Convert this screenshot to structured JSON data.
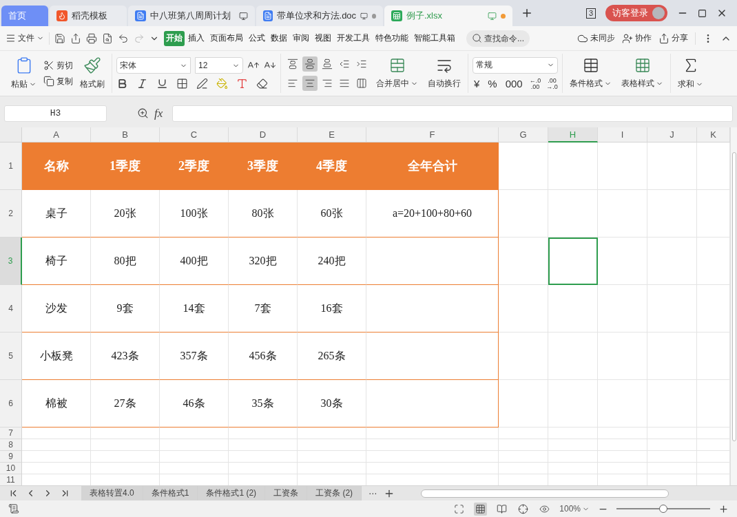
{
  "doc_tabs": [
    {
      "label": "首页",
      "kind": "home",
      "selected": false,
      "unsaved": false
    },
    {
      "label": "稻壳模板",
      "kind": "docer",
      "selected": false,
      "unsaved": false
    },
    {
      "label": "中八班第八周周计划",
      "kind": "word",
      "selected": false,
      "unsaved": false
    },
    {
      "label": "带单位求和方法.doc",
      "kind": "word",
      "selected": false,
      "unsaved": true
    },
    {
      "label": "例子.xlsx",
      "kind": "sheet",
      "selected": true,
      "unsaved": true
    }
  ],
  "window_badge": "3",
  "login": "访客登录",
  "file_menu": "文件",
  "menu": [
    {
      "label": "开始",
      "selected": true
    },
    {
      "label": "插入",
      "selected": false
    },
    {
      "label": "页面布局",
      "selected": false
    },
    {
      "label": "公式",
      "selected": false
    },
    {
      "label": "数据",
      "selected": false
    },
    {
      "label": "审阅",
      "selected": false
    },
    {
      "label": "视图",
      "selected": false
    },
    {
      "label": "开发工具",
      "selected": false
    },
    {
      "label": "特色功能",
      "selected": false
    },
    {
      "label": "智能工具箱",
      "selected": false
    }
  ],
  "search": {
    "placeholder": "查找命令..."
  },
  "sync": "未同步",
  "collab": "协作",
  "share": "分享",
  "ribbon": {
    "paste": "粘贴",
    "cut": "剪切",
    "copy": "复制",
    "painter": "格式刷",
    "font_name": "宋体",
    "font_size": "12",
    "align_buttons": [
      {
        "kind": "top",
        "pressed": false
      },
      {
        "kind": "middle",
        "pressed": true
      },
      {
        "kind": "bottom",
        "pressed": false
      },
      {
        "kind": "outdent",
        "pressed": false
      },
      {
        "kind": "indent",
        "pressed": false
      },
      {
        "kind": "left",
        "pressed": false
      },
      {
        "kind": "center",
        "pressed": true
      },
      {
        "kind": "right",
        "pressed": false
      },
      {
        "kind": "justify",
        "pressed": false
      },
      {
        "kind": "distribute",
        "pressed": false
      }
    ],
    "merge": "合并居中",
    "wrap": "自动换行",
    "number_format": "常规",
    "number_buttons": [
      "¥",
      "%",
      "000"
    ],
    "decimal_add": [
      "←.0",
      ".00"
    ],
    "decimal_remove": [
      ".00",
      "→.0"
    ],
    "cond_format": "条件格式",
    "table_style": "表格样式",
    "sum": "求和"
  },
  "name_box": "H3",
  "fx": "fx",
  "columns": [
    {
      "label": "A",
      "selected": false
    },
    {
      "label": "B",
      "selected": false
    },
    {
      "label": "C",
      "selected": false
    },
    {
      "label": "D",
      "selected": false
    },
    {
      "label": "E",
      "selected": false
    },
    {
      "label": "F",
      "selected": false
    },
    {
      "label": "G",
      "selected": false
    },
    {
      "label": "H",
      "selected": true
    },
    {
      "label": "I",
      "selected": false
    },
    {
      "label": "J",
      "selected": false
    },
    {
      "label": "K",
      "selected": false
    }
  ],
  "rows": [
    {
      "label": "1",
      "kind": "header",
      "selected": false,
      "cells": [
        "名称",
        "1季度",
        "2季度",
        "3季度",
        "4季度",
        "全年合计"
      ]
    },
    {
      "label": "2",
      "kind": "data",
      "selected": false,
      "cells": [
        "桌子",
        "20张",
        "100张",
        "80张",
        "60张",
        "a=20+100+80+60"
      ]
    },
    {
      "label": "3",
      "kind": "data",
      "selected": true,
      "cells": [
        "椅子",
        "80把",
        "400把",
        "320把",
        "240把"
      ]
    },
    {
      "label": "4",
      "kind": "data",
      "selected": false,
      "cells": [
        "沙发",
        "9套",
        "14套",
        "7套",
        "16套"
      ]
    },
    {
      "label": "5",
      "kind": "data",
      "selected": false,
      "cells": [
        "小板凳",
        "423条",
        "357条",
        "456条",
        "265条"
      ]
    },
    {
      "label": "6",
      "kind": "data",
      "selected": false,
      "cells": [
        "棉被",
        "27条",
        "46条",
        "35条",
        "30条"
      ]
    },
    {
      "label": "7",
      "kind": "blank",
      "selected": false
    },
    {
      "label": "8",
      "kind": "blank",
      "selected": false
    },
    {
      "label": "9",
      "kind": "blank",
      "selected": false
    },
    {
      "label": "10",
      "kind": "blank",
      "selected": false
    },
    {
      "label": "11",
      "kind": "blank",
      "selected": false
    }
  ],
  "sheet_tabs": [
    {
      "label": "表格转置4.0",
      "selected": false
    },
    {
      "label": "条件格式1",
      "selected": false
    },
    {
      "label": "条件格式1 (2)",
      "selected": false
    },
    {
      "label": "工资条",
      "selected": false
    },
    {
      "label": "工资条 (2)",
      "selected": false
    }
  ],
  "sheet_more": "⋯",
  "zoom": {
    "reading": "100%",
    "level": 0.5
  }
}
